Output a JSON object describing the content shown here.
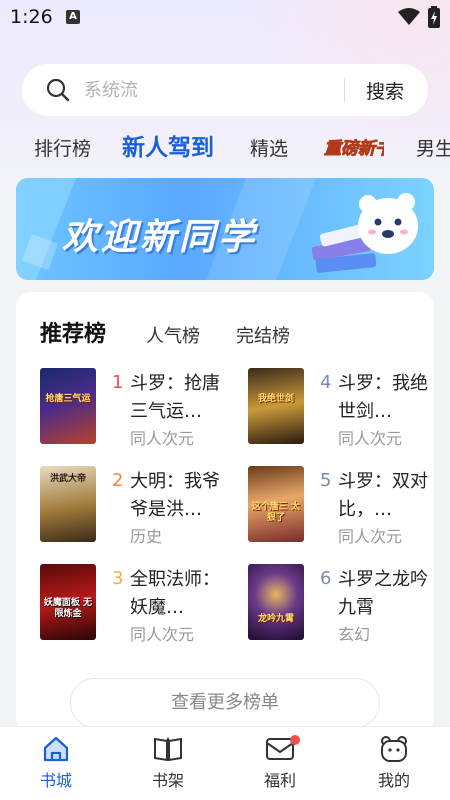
{
  "status_bar": {
    "time": "1:26",
    "notification_icon": "a-app-icon",
    "icons": [
      "wifi-icon",
      "battery-charging-icon"
    ]
  },
  "search": {
    "placeholder": "系统流",
    "button": "搜索",
    "icon": "search-icon"
  },
  "tabs": [
    {
      "label": "排行榜",
      "active": false
    },
    {
      "label": "新人驾到",
      "active": true
    },
    {
      "label": "精选",
      "active": false
    },
    {
      "label": "重磅新书",
      "active": false,
      "style": "image-badge"
    },
    {
      "label": "男生",
      "active": false
    }
  ],
  "banner": {
    "text": "欢迎新同学",
    "art": "bear-with-books-illustration"
  },
  "ranking": {
    "tabs": [
      "推荐榜",
      "人气榜",
      "完结榜"
    ],
    "active_tab": "推荐榜",
    "books": [
      {
        "rank": "1",
        "title": "斗罗：抢唐三气运…",
        "category": "同人次元",
        "cover_text": "抢唐三气运",
        "rank_color": "#f24e4e"
      },
      {
        "rank": "2",
        "title": "大明：我爷爷是洪…",
        "category": "历史",
        "cover_text": "洪武大帝",
        "rank_color": "#f2873a"
      },
      {
        "rank": "3",
        "title": "全职法师：妖魔…",
        "category": "同人次元",
        "cover_text": "妖魔面板 无限炼金",
        "rank_color": "#f2b23a"
      },
      {
        "rank": "4",
        "title": "斗罗：我绝世剑…",
        "category": "同人次元",
        "cover_text": "我绝世剑",
        "rank_color": "#7b8bb0"
      },
      {
        "rank": "5",
        "title": "斗罗：双对比，…",
        "category": "同人次元",
        "cover_text": "这个唐三 太狠了",
        "rank_color": "#7b8bb0"
      },
      {
        "rank": "6",
        "title": "斗罗之龙吟九霄",
        "category": "玄幻",
        "cover_text": "龙吟九霄",
        "rank_color": "#7b8bb0"
      }
    ],
    "more_button": "查看更多榜单"
  },
  "bottom_nav": [
    {
      "label": "书城",
      "icon": "home-icon",
      "active": true
    },
    {
      "label": "书架",
      "icon": "book-icon",
      "active": false
    },
    {
      "label": "福利",
      "icon": "envelope-icon",
      "active": false,
      "badge": true
    },
    {
      "label": "我的",
      "icon": "profile-icon",
      "active": false
    }
  ],
  "colors": {
    "accent": "#1a5fd9",
    "badge": "#f24e4e",
    "muted": "#999999"
  }
}
